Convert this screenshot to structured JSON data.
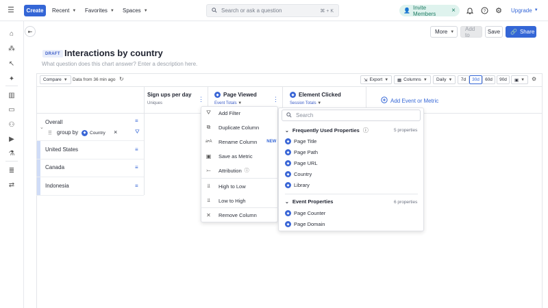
{
  "topbar": {
    "create": "Create",
    "recent": "Recent",
    "favorites": "Favorites",
    "spaces": "Spaces",
    "search_placeholder": "Search or ask a question",
    "search_shortcut": "⌘ + K",
    "invite": "Invite Members",
    "upgrade": "Upgrade"
  },
  "header": {
    "more": "More",
    "add_to": "Add to",
    "save": "Save",
    "share": "Share",
    "draft": "DRAFT",
    "title": "Interactions by country",
    "subtitle": "What question does this chart answer? Enter a description here."
  },
  "toolbar": {
    "compare": "Compare",
    "data_age": "Data from 36 min ago",
    "export": "Export",
    "columns": "Columns",
    "interval": "Daily",
    "ranges": [
      "7d",
      "30d",
      "60d",
      "90d"
    ],
    "active_range": "30d"
  },
  "columns": [
    {
      "title": "Sign ups per day",
      "subtitle": "Uniques"
    },
    {
      "title": "Page Viewed",
      "subtitle": "Event Totals"
    },
    {
      "title": "Element Clicked",
      "subtitle": "Session Totals"
    }
  ],
  "add_event": "Add Event or Metric",
  "rows": {
    "overall": "Overall",
    "group_by": "group by",
    "group_chip": "Country",
    "items": [
      "United States",
      "Canada",
      "Indonesia"
    ]
  },
  "context_menu": {
    "items": [
      "Add Filter",
      "Duplicate Column",
      "Rename Column",
      "Save as Metric",
      "Attribution",
      "High to Low",
      "Low to High",
      "Remove Column"
    ],
    "new_badge": "NEW"
  },
  "property_menu": {
    "search_placeholder": "Search",
    "section1": {
      "title": "Frequently Used Properties",
      "count": "5 properties",
      "items": [
        "Page Title",
        "Page Path",
        "Page URL",
        "Country",
        "Library"
      ]
    },
    "section2": {
      "title": "Event Properties",
      "count": "6 properties",
      "items": [
        "Page Counter",
        "Page Domain"
      ]
    }
  },
  "colors": {
    "accent": "#3466d6",
    "invite_bg": "#dff3ee",
    "invite_fg": "#1e7b63"
  }
}
